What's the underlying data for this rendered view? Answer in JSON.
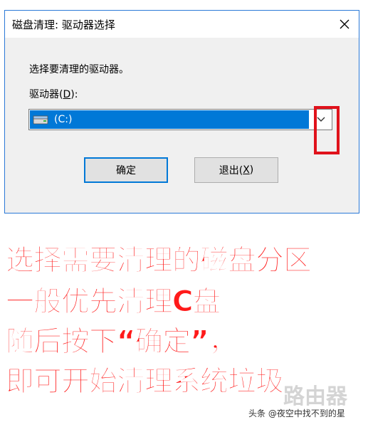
{
  "dialog": {
    "title": "磁盘清理: 驱动器选择",
    "prompt": "选择要清理的驱动器。",
    "drive_label_prefix": "驱动器(",
    "drive_label_key": "D",
    "drive_label_suffix": "):",
    "selected_drive": "(C:)",
    "ok_label": "确定",
    "cancel_label_prefix": "退出(",
    "cancel_label_key": "X",
    "cancel_label_suffix": ")"
  },
  "caption": {
    "line1": "选择需要清理的磁盘分区",
    "line2": "一般优先清理C盘",
    "line3": "随后按下“确定”，",
    "line4": "即可开始清理系统垃圾。"
  },
  "watermark": {
    "logo_text": "路由器",
    "credit": "头条 @夜空中找不到的星"
  },
  "colors": {
    "accent": "#0078d7",
    "highlight": "#e0121b",
    "caption": "#ff1a1a"
  }
}
